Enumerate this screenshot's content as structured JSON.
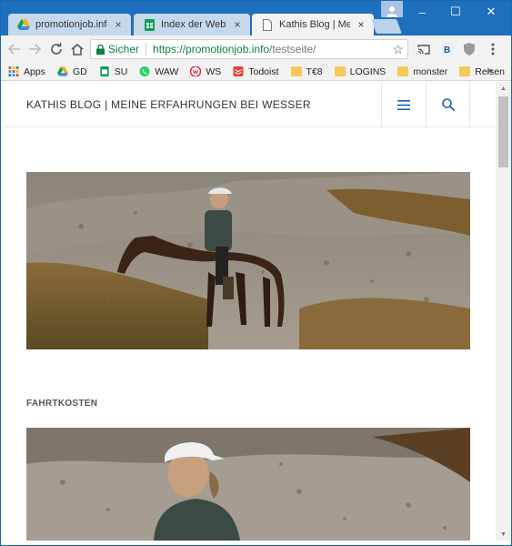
{
  "tabs": [
    {
      "label": "promotionjob.info",
      "icon": "drive-icon",
      "close": "×"
    },
    {
      "label": "Index der Webseite",
      "icon": "sheets-icon",
      "close": "×"
    },
    {
      "label": "Kathis Blog | Meine",
      "icon": "page-icon",
      "close": "×",
      "active": true
    }
  ],
  "window_controls": {
    "minimize": "–",
    "maximize": "☐",
    "close": "✕"
  },
  "toolbar": {
    "secure_label": "Sicher",
    "url_host": "https://promotionjob.info",
    "url_path": "/testseite/"
  },
  "bookmarks": [
    {
      "label": "Apps",
      "icon": "apps-grid-icon"
    },
    {
      "label": "GD",
      "icon": "drive-icon"
    },
    {
      "label": "SU",
      "icon": "sheets-icon"
    },
    {
      "label": "WAW",
      "icon": "whatsapp-icon"
    },
    {
      "label": "WS",
      "icon": "ws-icon"
    },
    {
      "label": "Todoist",
      "icon": "todoist-icon"
    },
    {
      "label": "T€8",
      "icon": "folder-icon"
    },
    {
      "label": "LOGINS",
      "icon": "folder-icon"
    },
    {
      "label": "monster",
      "icon": "folder-icon"
    },
    {
      "label": "Reisen",
      "icon": "folder-icon"
    }
  ],
  "bookmarks_more": "»",
  "site": {
    "title": "KATHIS BLOG | MEINE ERFAHRUNGEN BEI WESSER",
    "section_heading": "FAHRTKOSTEN"
  },
  "colors": {
    "titlebar": "#1e6fbd",
    "accent_link": "#1e5fa8",
    "secure_green": "#0b8043"
  }
}
